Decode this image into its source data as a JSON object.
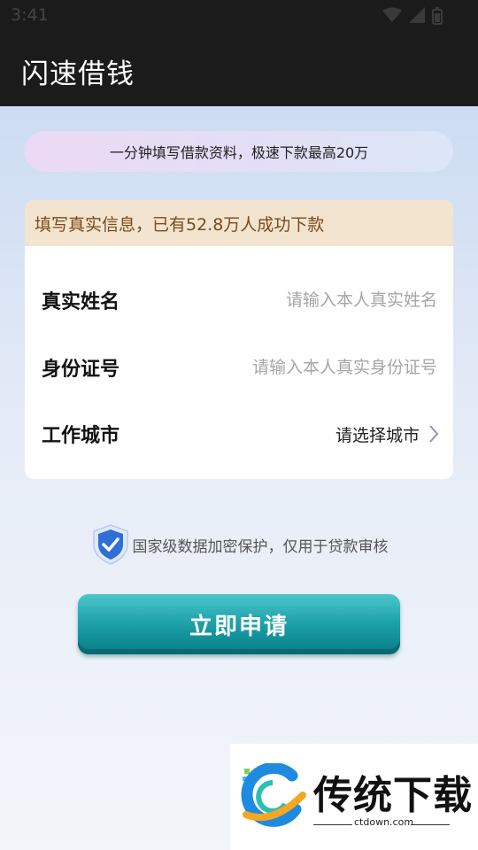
{
  "status_bar": {
    "time": "3:41"
  },
  "app_bar": {
    "title": "闪速借钱"
  },
  "promo": {
    "text": "一分钟填写借款资料，极速下款最高20万"
  },
  "form": {
    "header": "填写真实信息，已有52.8万人成功下款",
    "name": {
      "label": "真实姓名",
      "placeholder": "请输入本人真实姓名"
    },
    "id_number": {
      "label": "身份证号",
      "placeholder": "请输入本人真实身份证号"
    },
    "city": {
      "label": "工作城市",
      "value": "请选择城市",
      "icon": "chevron-right-icon"
    }
  },
  "security": {
    "icon": "shield-check-icon",
    "text": "国家级数据加密保护，仅用于贷款审核"
  },
  "apply_button": {
    "label": "立即申请"
  },
  "watermark": {
    "title": "传统下载",
    "site": "ctdown.com"
  },
  "colors": {
    "app_bar": "#1b1b1b",
    "card_header_bg": "#f2e4cf",
    "card_header_text": "#7a4a1c",
    "button": "#1fa3ab"
  }
}
